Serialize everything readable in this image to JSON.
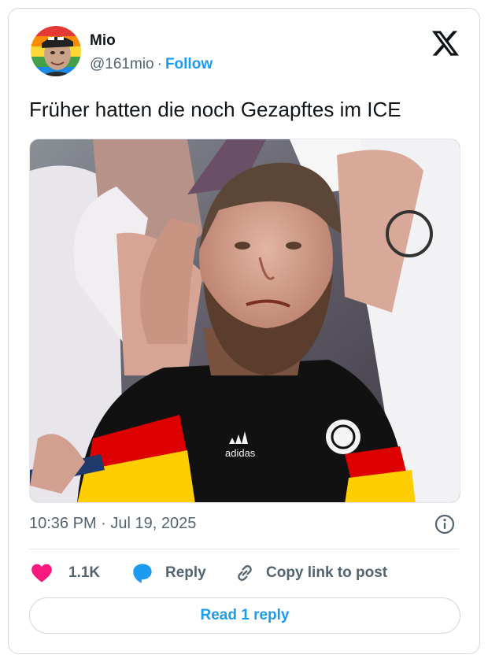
{
  "author": {
    "name": "Mio",
    "handle": "@161mio",
    "separator": "·",
    "follow_label": "Follow"
  },
  "tweet": {
    "text": "Früher hatten die noch Gezapftes im ICE",
    "timestamp": "10:36 PM · Jul 19, 2025"
  },
  "media": {
    "jacket_brand": "adidas",
    "colors": [
      "#000000",
      "#dd0000",
      "#ffce00"
    ]
  },
  "actions": {
    "likes": "1.1K",
    "reply_label": "Reply",
    "copy_label": "Copy link to post"
  },
  "read_replies_label": "Read 1 reply",
  "colors": {
    "accent": "#1d9bf0",
    "like": "#f91880",
    "text": "#0f1419",
    "muted": "#536471",
    "border": "#cfd9de"
  },
  "icons": [
    "x-logo-icon",
    "info-icon",
    "heart-icon",
    "reply-bubble-icon",
    "link-icon"
  ]
}
